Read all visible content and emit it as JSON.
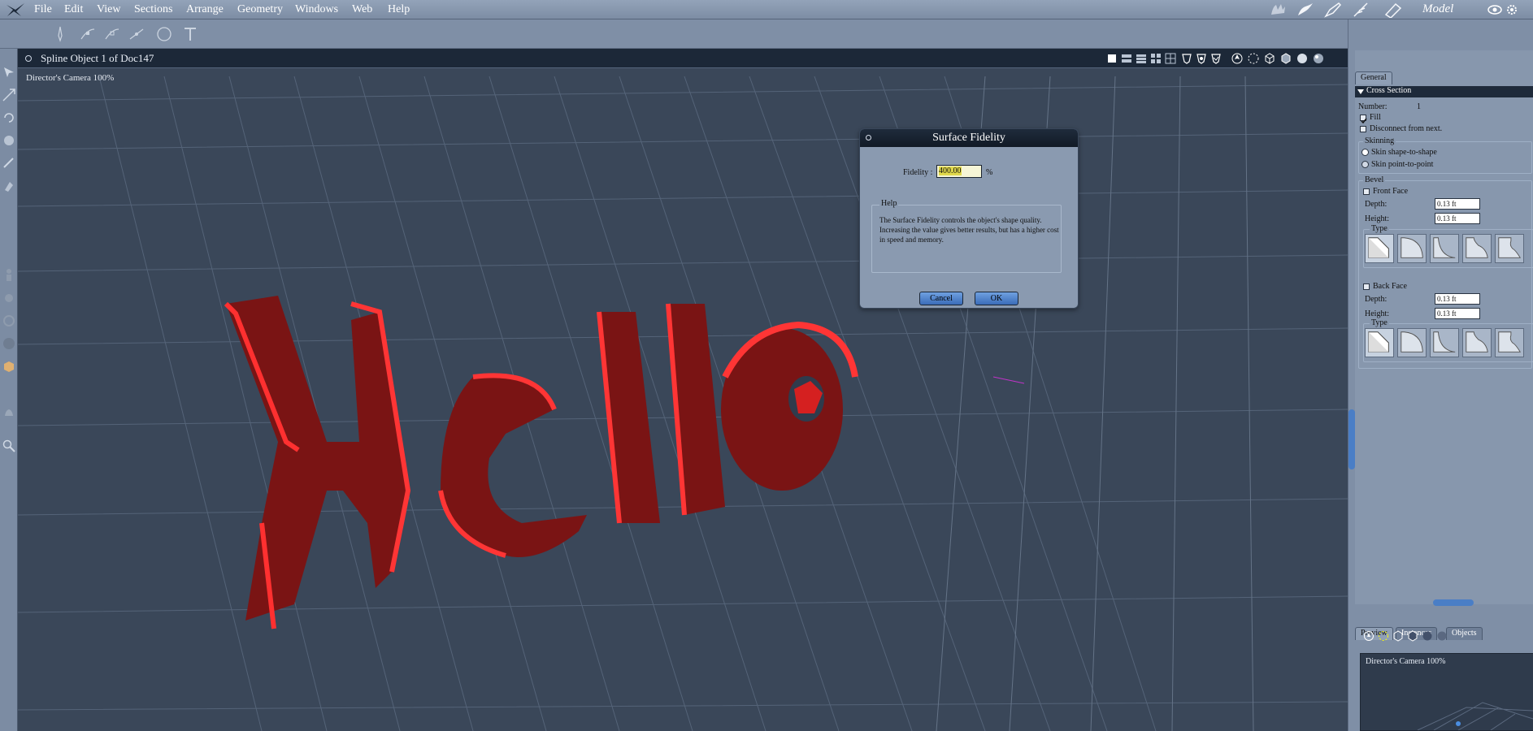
{
  "menubar": {
    "items": [
      "File",
      "Edit",
      "View",
      "Sections",
      "Arrange",
      "Geometry",
      "Windows",
      "Web",
      "Help"
    ],
    "room_label": "Model"
  },
  "viewport": {
    "title": "Spline Object 1 of Doc147",
    "camera_label": "Director's Camera 100%",
    "scene_text": "Hello",
    "text_color": "#e02020",
    "grid_color": "#66768c"
  },
  "properties": {
    "tab_general": "General",
    "section": "Cross Section",
    "number_label": "Number:",
    "number_value": "1",
    "fill_label": "Fill",
    "fill_checked": true,
    "disconnect_label": "Disconnect from next.",
    "skinning_label": "Skinning",
    "skin_shape": "Skin shape-to-shape",
    "skin_point": "Skin point-to-point",
    "bevel_label": "Bevel",
    "front_face": "Front Face",
    "back_face": "Back Face",
    "depth_label": "Depth:",
    "height_label": "Height:",
    "front_depth": "0.13 ft",
    "front_height": "0.13 ft",
    "back_depth": "0.13 ft",
    "back_height": "0.13 ft",
    "type_label": "Type"
  },
  "preview": {
    "tabs": [
      "Preview",
      "Instances",
      "Objects"
    ],
    "camera_label": "Director's Camera 100%"
  },
  "dialog": {
    "title": "Surface Fidelity",
    "fidelity_label": "Fidelity :",
    "fidelity_value": "400.00",
    "fidelity_unit": "%",
    "help_legend": "Help",
    "help_text": "The Surface Fidelity controls the object's shape quality. Increasing the value gives better results, but has a higher cost in speed and memory.",
    "cancel_label": "Cancel",
    "ok_label": "OK"
  },
  "colors": {
    "accent": "#4a7ec6"
  }
}
